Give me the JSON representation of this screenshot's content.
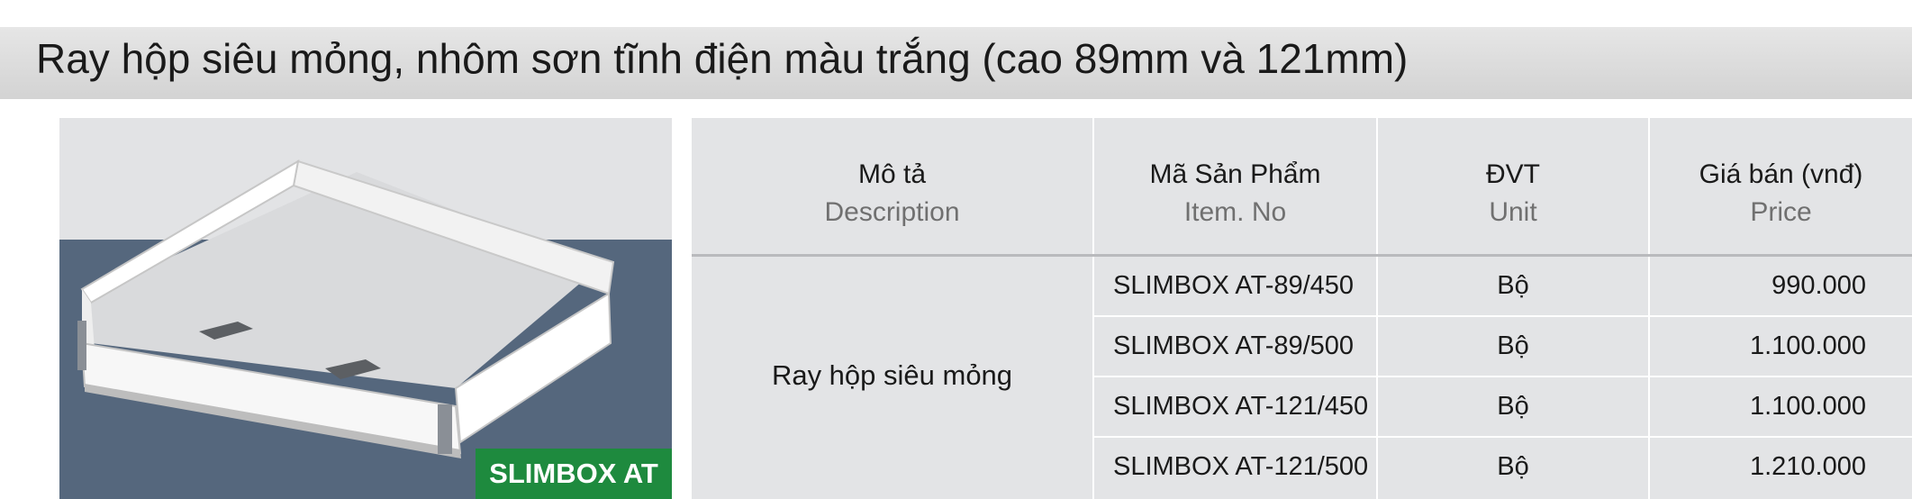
{
  "title": "Ray hộp siêu mỏng, nhôm sơn tĩnh điện màu trắng (cao 89mm và 121mm)",
  "product_image": {
    "label": "SLIMBOX AT",
    "label_color": "#1e8a3e"
  },
  "table": {
    "headers": [
      {
        "vi": "Mô tả",
        "en": "Description"
      },
      {
        "vi": "Mã Sản Phẩm",
        "en": "Item. No"
      },
      {
        "vi": "ĐVT",
        "en": "Unit"
      },
      {
        "vi": "Giá bán (vnđ)",
        "en": "Price"
      }
    ],
    "description": "Ray hộp siêu mỏng",
    "rows": [
      {
        "item": "SLIMBOX AT-89/450",
        "unit": "Bộ",
        "price": "990.000"
      },
      {
        "item": "SLIMBOX AT-89/500",
        "unit": "Bộ",
        "price": "1.100.000"
      },
      {
        "item": "SLIMBOX AT-121/450",
        "unit": "Bộ",
        "price": "1.100.000"
      },
      {
        "item": "SLIMBOX AT-121/500",
        "unit": "Bộ",
        "price": "1.210.000"
      }
    ]
  }
}
